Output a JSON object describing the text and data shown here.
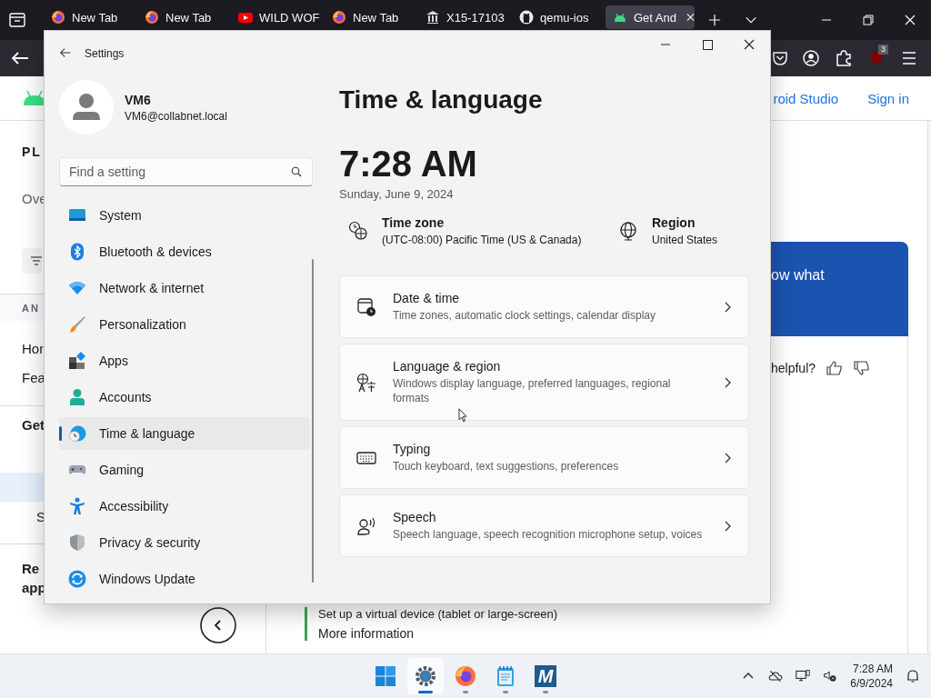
{
  "browser": {
    "tabs": [
      {
        "title": "New Tab",
        "selected": false
      },
      {
        "title": "New Tab",
        "selected": false
      },
      {
        "title": "WILD WOF",
        "selected": false
      },
      {
        "title": "New Tab",
        "selected": false
      },
      {
        "title": "X15-17103",
        "selected": false
      },
      {
        "title": "qemu-ios",
        "selected": false
      },
      {
        "title": "Get And",
        "selected": true
      }
    ],
    "extension_badge": "3",
    "page": {
      "nav": {
        "section_title": "PL",
        "overview": "Ove",
        "group_label": "AN",
        "items": [
          {
            "label": "Hon"
          },
          {
            "label": "Fea"
          }
        ],
        "heading": "Get",
        "subitems": [
          {
            "selected": false
          },
          {
            "selected": true
          },
          {
            "label": "S",
            "selected": false
          }
        ],
        "footer_heading": [
          "Re",
          "app"
        ]
      },
      "header_links": [
        {
          "label": "roid Studio"
        },
        {
          "label": "Sign in"
        }
      ],
      "banner_text": "ow what",
      "feedback_prompt": "helpful?",
      "note": {
        "items": [
          "Set up a virtual device (tablet or large-screen)",
          "More information"
        ]
      }
    }
  },
  "settings": {
    "title": "Settings",
    "user": {
      "name": "VM6",
      "email": "VM6@collabnet.local"
    },
    "search": {
      "placeholder": "Find a setting"
    },
    "nav": [
      {
        "label": "System",
        "selected": false
      },
      {
        "label": "Bluetooth & devices",
        "selected": false
      },
      {
        "label": "Network & internet",
        "selected": false
      },
      {
        "label": "Personalization",
        "selected": false
      },
      {
        "label": "Apps",
        "selected": false
      },
      {
        "label": "Accounts",
        "selected": false
      },
      {
        "label": "Time & language",
        "selected": true
      },
      {
        "label": "Gaming",
        "selected": false
      },
      {
        "label": "Accessibility",
        "selected": false
      },
      {
        "label": "Privacy & security",
        "selected": false
      },
      {
        "label": "Windows Update",
        "selected": false
      }
    ],
    "page_title": "Time & language",
    "time": "7:28 AM",
    "date": "Sunday, June 9, 2024",
    "info": [
      {
        "label": "Time zone",
        "value": "(UTC-08:00) Pacific Time (US & Canada)"
      },
      {
        "label": "Region",
        "value": "United States"
      }
    ],
    "cards": [
      {
        "title": "Date & time",
        "description": "Time zones, automatic clock settings, calendar display"
      },
      {
        "title": "Language & region",
        "description": "Windows display language, preferred languages, regional formats"
      },
      {
        "title": "Typing",
        "description": "Touch keyboard, text suggestions, preferences"
      },
      {
        "title": "Speech",
        "description": "Speech language, speech recognition microphone setup, voices"
      }
    ]
  },
  "taskbar": {
    "apps": [
      {
        "selected": true
      },
      {
        "selected": false
      },
      {
        "selected": false
      },
      {
        "selected": false,
        "label": "M"
      }
    ],
    "clock": {
      "time": "7:28 AM",
      "date": "6/9/2024"
    }
  }
}
